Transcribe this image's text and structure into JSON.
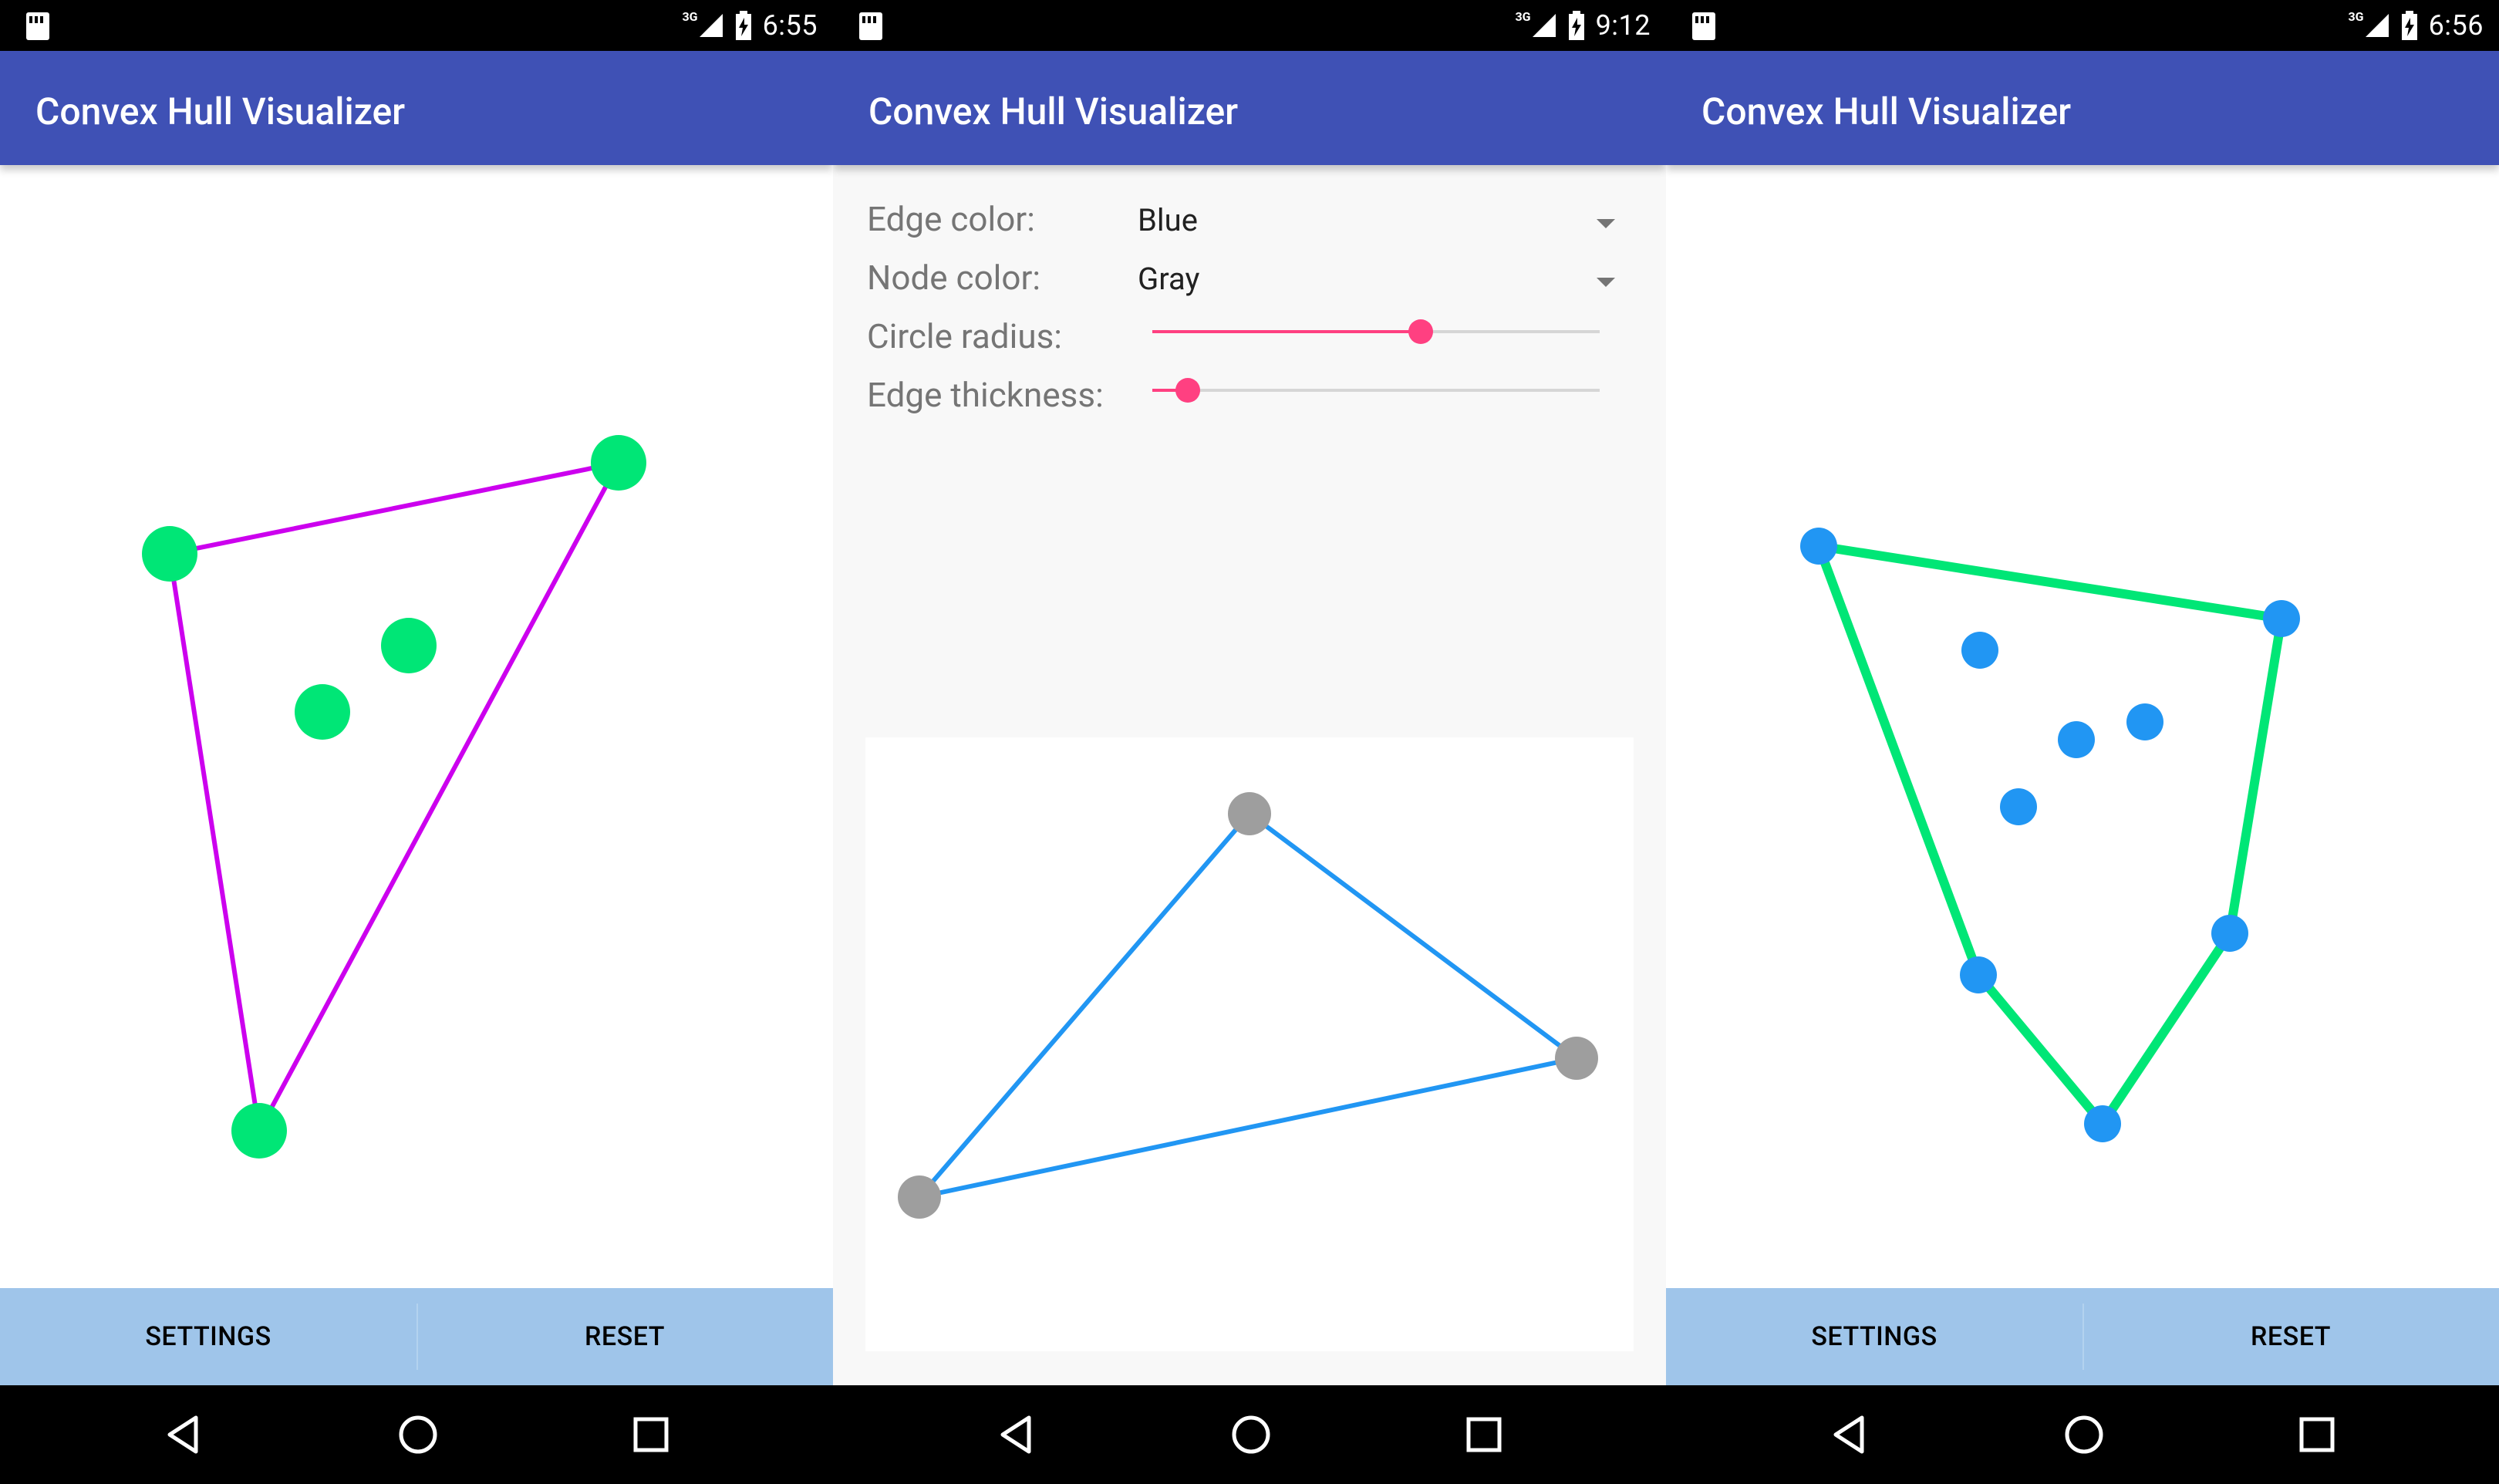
{
  "app_title": "Convex Hull Visualizer",
  "status_bars": [
    {
      "network": "3G",
      "time": "6:55"
    },
    {
      "network": "3G",
      "time": "9:12"
    },
    {
      "network": "3G",
      "time": "6:56"
    }
  ],
  "buttons": {
    "settings": "SETTINGS",
    "reset": "RESET"
  },
  "settings": {
    "edge_color_label": "Edge color:",
    "edge_color_value": "Blue",
    "node_color_label": "Node color:",
    "node_color_value": "Gray",
    "circle_radius_label": "Circle radius:",
    "circle_radius_level": 0.6,
    "edge_thickness_label": "Edge thickness:",
    "edge_thickness_level": 0.08
  },
  "colors": {
    "appbar": "#3f51b5",
    "button_bar": "#9fc5ea",
    "accent": "#ff4081",
    "screen1_edge": "#cc00ee",
    "screen1_node": "#00e676",
    "preview_edge": "#2196f3",
    "preview_node": "#9e9e9e",
    "screen3_edge": "#00e676",
    "screen3_node": "#2196f3"
  },
  "icons": {
    "sd_card": "sd-card-icon",
    "signal": "signal-icon",
    "battery": "battery-icon",
    "back": "back-icon",
    "home": "home-icon",
    "recents": "recents-icon"
  }
}
